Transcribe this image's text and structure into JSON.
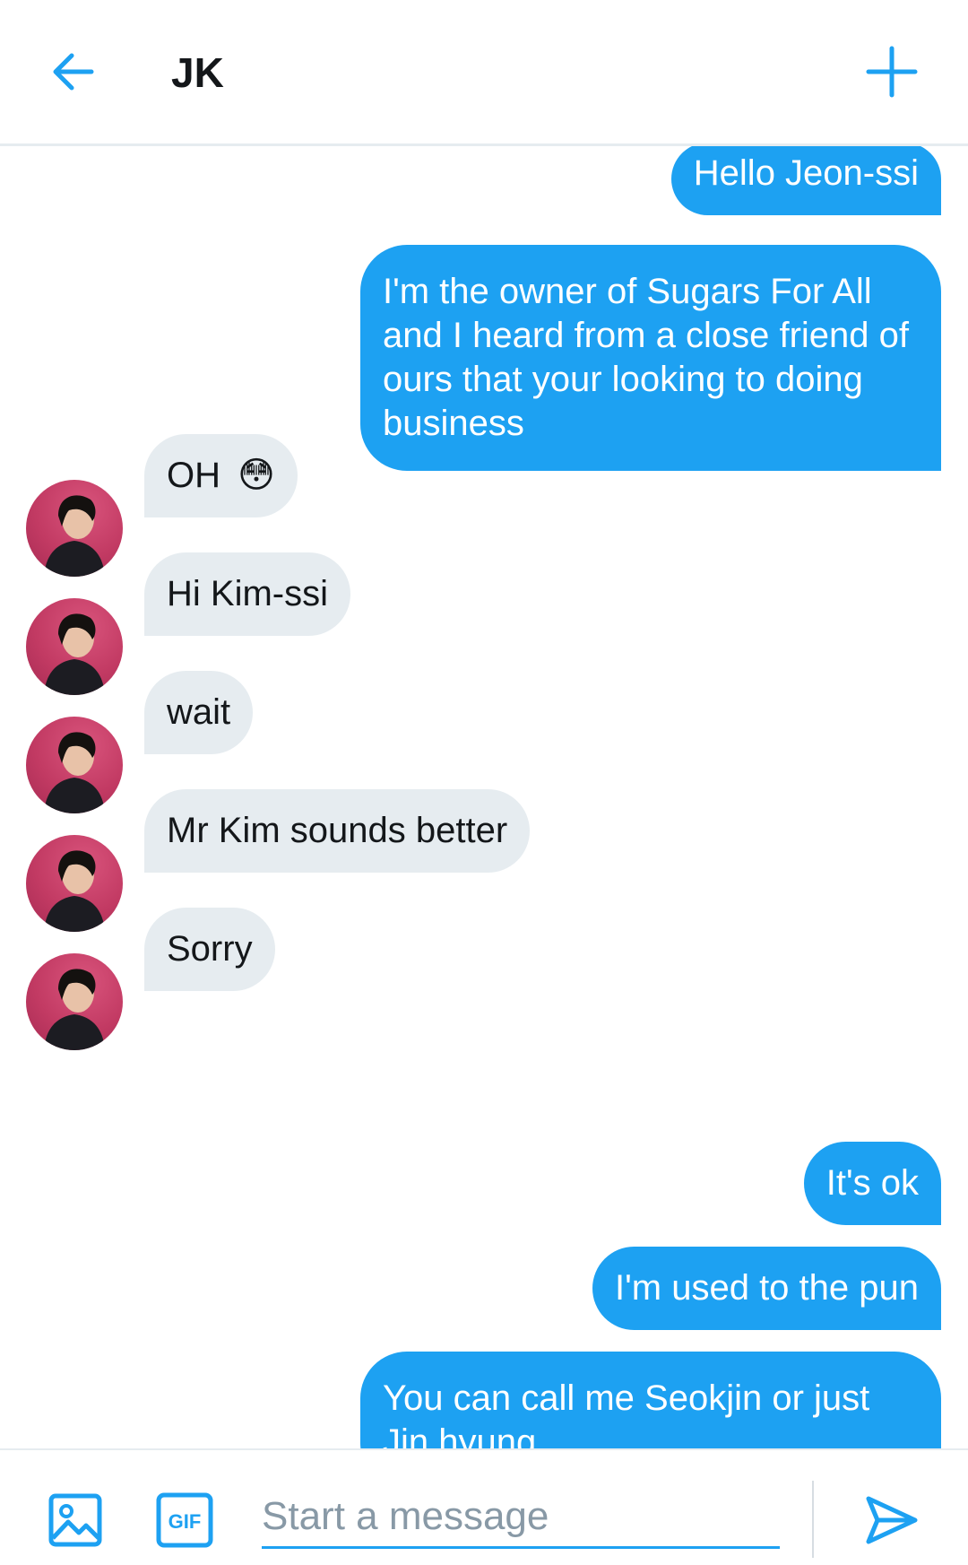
{
  "header": {
    "back_icon": "arrow-left-icon",
    "title": "JK",
    "new_icon": "plus-icon"
  },
  "colors": {
    "accent": "#1da1f2",
    "incoming_bubble": "#e6ecf0",
    "avatar_bg": "#c23a63"
  },
  "messages": [
    {
      "from": "me",
      "text": "Hello Jeon-ssi"
    },
    {
      "from": "me",
      "text": "I'm the owner of Sugars For All and I heard from a close friend of ours that your looking to doing business"
    },
    {
      "from": "them",
      "text": "OH",
      "emoji": "😳"
    },
    {
      "from": "them",
      "text": "Hi Kim-ssi"
    },
    {
      "from": "them",
      "text": "wait"
    },
    {
      "from": "them",
      "text": "Mr Kim sounds better"
    },
    {
      "from": "them",
      "text": "Sorry"
    },
    {
      "from": "me",
      "text": "It's ok"
    },
    {
      "from": "me",
      "text": "I'm used to the pun"
    },
    {
      "from": "me",
      "text": "You can call me Seokjin or just Jin hyung"
    }
  ],
  "composer": {
    "image_icon": "image-icon",
    "gif_icon": "gif-icon",
    "gif_label": "GIF",
    "placeholder": "Start a message",
    "send_icon": "send-icon"
  }
}
